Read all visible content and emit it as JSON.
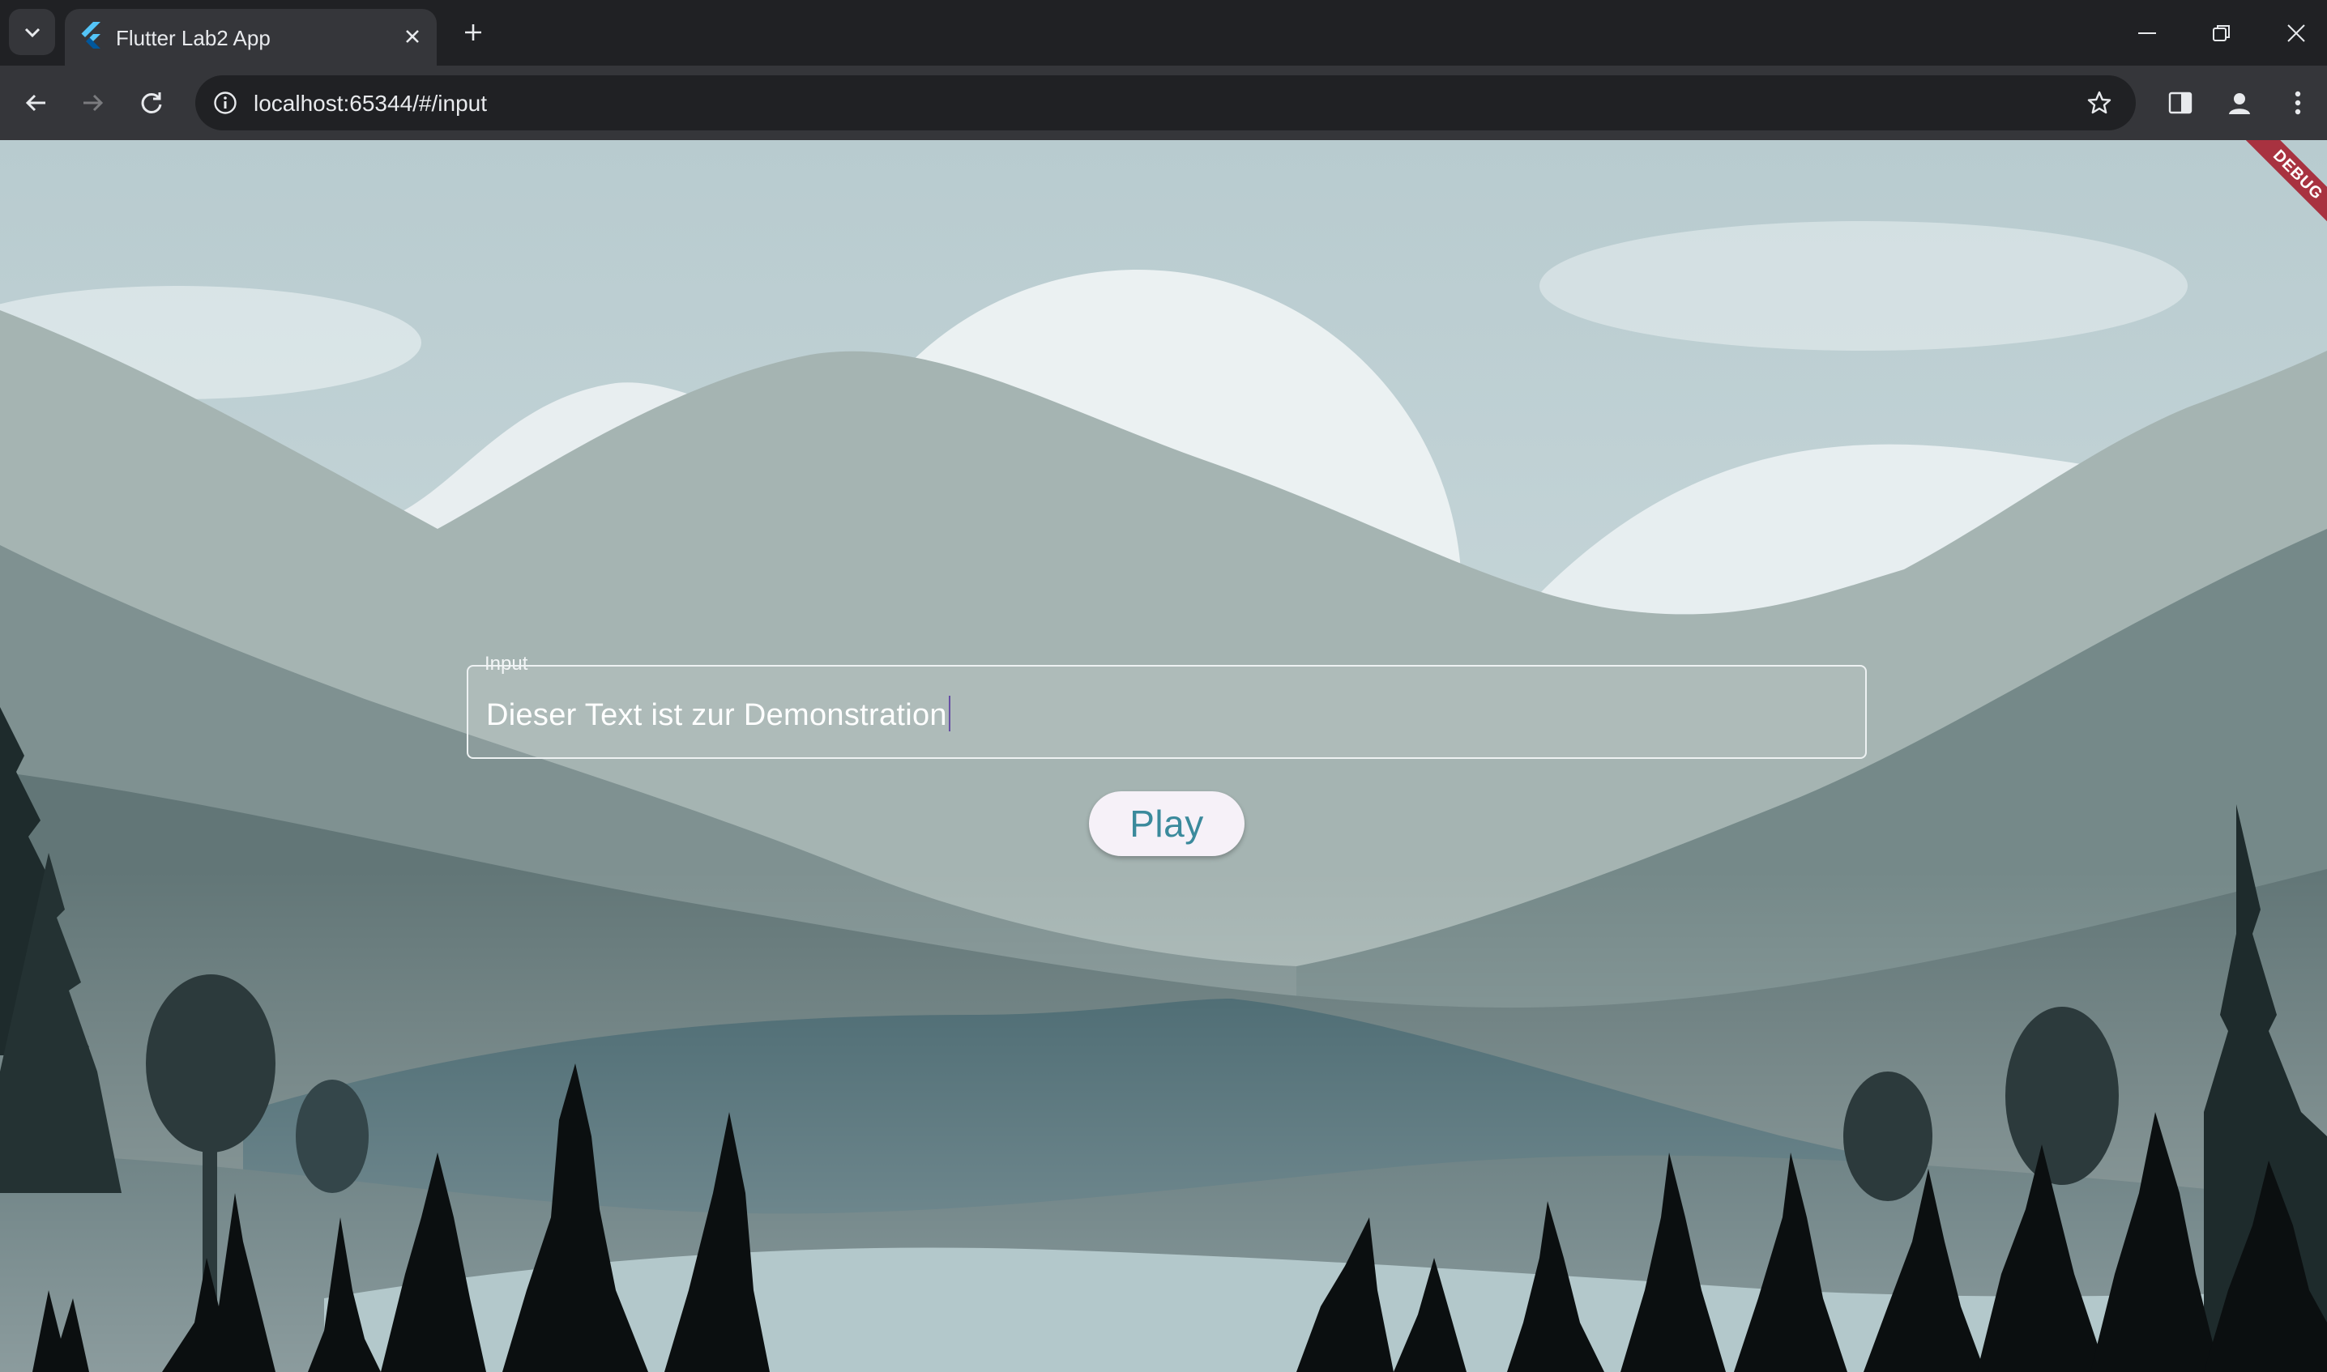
{
  "browser": {
    "tab": {
      "title": "Flutter Lab2 App"
    },
    "address_bar": {
      "url": "localhost:65344/#/input"
    }
  },
  "app": {
    "debug_banner": "DEBUG",
    "input": {
      "label": "Input",
      "value": "Dieser Text ist zur Demonstration"
    },
    "play_button": {
      "label": "Play"
    }
  },
  "colors": {
    "browser_frame": "#202124",
    "toolbar": "#35363a",
    "play_text": "#3b8a9c",
    "caret": "#6750a4",
    "debug_banner": "#a83240"
  }
}
